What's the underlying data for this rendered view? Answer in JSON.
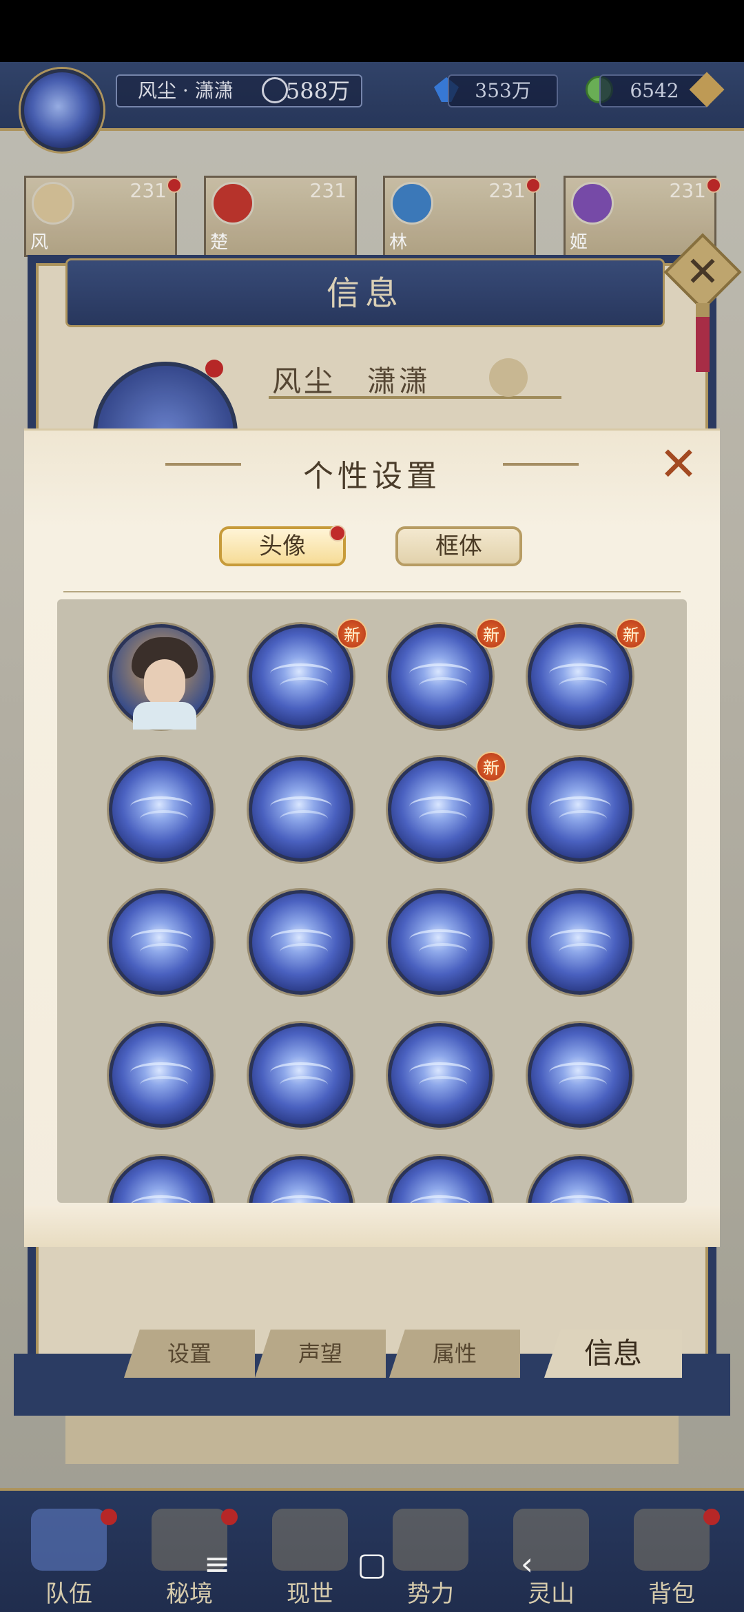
{
  "topbar": {
    "player_name": "风尘 · 潇潇",
    "power": "588万",
    "crystals": "353万",
    "jade": "6542"
  },
  "heroes": [
    {
      "name": "风",
      "level": "231",
      "has_dot": true,
      "elem_color": "#d9c49a"
    },
    {
      "name": "楚",
      "level": "231",
      "has_dot": false,
      "elem_color": "#c0362e"
    },
    {
      "name": "林",
      "level": "231",
      "has_dot": true,
      "elem_color": "#3f7fc2"
    },
    {
      "name": "姬",
      "level": "231",
      "has_dot": true,
      "elem_color": "#7d4fb0"
    }
  ],
  "info_panel": {
    "title": "信息",
    "name": "风尘　潇潇",
    "tabs": [
      "设置",
      "声望",
      "属性",
      "信息"
    ],
    "active_tab": "信息"
  },
  "modal": {
    "title": "个性设置",
    "tabs": [
      "头像",
      "框体"
    ],
    "active_tab": "头像",
    "new_badge": "新",
    "avatars": [
      {
        "type": "hero",
        "is_new": false
      },
      {
        "type": "cloud",
        "is_new": true
      },
      {
        "type": "cloud",
        "is_new": true
      },
      {
        "type": "cloud",
        "is_new": true
      },
      {
        "type": "cloud",
        "is_new": false
      },
      {
        "type": "cloud",
        "is_new": false
      },
      {
        "type": "cloud",
        "is_new": true
      },
      {
        "type": "cloud",
        "is_new": false
      },
      {
        "type": "cloud",
        "is_new": false
      },
      {
        "type": "cloud",
        "is_new": false
      },
      {
        "type": "cloud",
        "is_new": false
      },
      {
        "type": "cloud",
        "is_new": false
      },
      {
        "type": "cloud",
        "is_new": false
      },
      {
        "type": "cloud",
        "is_new": false
      },
      {
        "type": "cloud",
        "is_new": false
      },
      {
        "type": "cloud",
        "is_new": false
      },
      {
        "type": "cloud",
        "is_new": false
      },
      {
        "type": "cloud",
        "is_new": false
      },
      {
        "type": "cloud",
        "is_new": false
      },
      {
        "type": "cloud",
        "is_new": false
      }
    ]
  },
  "bottom_nav": [
    {
      "label": "队伍",
      "active": true,
      "has_dot": true
    },
    {
      "label": "秘境",
      "active": false,
      "has_dot": true
    },
    {
      "label": "现世",
      "active": false,
      "has_dot": false
    },
    {
      "label": "势力",
      "active": false,
      "has_dot": false
    },
    {
      "label": "灵山",
      "active": false,
      "has_dot": false
    },
    {
      "label": "背包",
      "active": false,
      "has_dot": true
    }
  ],
  "system_nav": [
    "≡",
    "▢",
    "‹"
  ]
}
